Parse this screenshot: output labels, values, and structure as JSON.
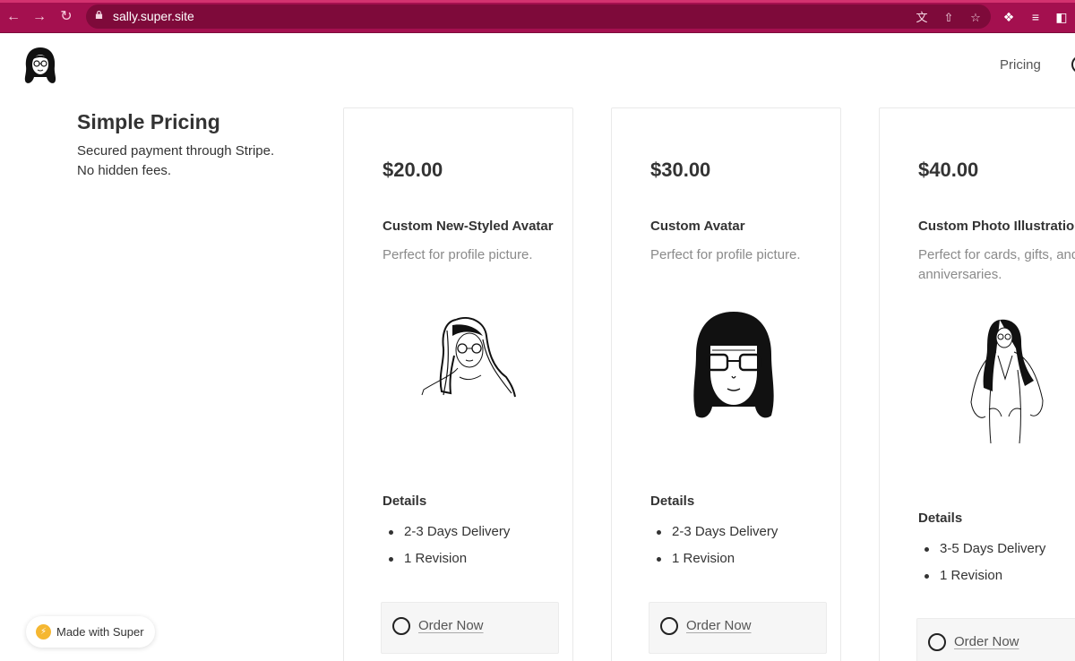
{
  "browser": {
    "url": "sally.super.site",
    "theme_color": "#a4104f"
  },
  "header": {
    "nav_pricing": "Pricing"
  },
  "intro": {
    "title": "Simple Pricing",
    "line1": "Secured payment through Stripe.",
    "line2": "No hidden fees."
  },
  "cards": [
    {
      "price": "$20.00",
      "name": "Custom New-Styled Avatar",
      "description": "Perfect for profile picture.",
      "illustration": "avatar-sketch-icon",
      "details_label": "Details",
      "details": [
        "2-3 Days Delivery",
        "1 Revision"
      ],
      "button_label": "Order Now"
    },
    {
      "price": "$30.00",
      "name": "Custom Avatar",
      "description": "Perfect for profile picture.",
      "illustration": "avatar-bold-icon",
      "details_label": "Details",
      "details": [
        "2-3 Days Delivery",
        "1 Revision"
      ],
      "button_label": "Order Now"
    },
    {
      "price": "$40.00",
      "name": "Custom Photo Illustration",
      "description": "Perfect for cards, gifts, and anniversaries.",
      "illustration": "full-body-illustration-icon",
      "details_label": "Details",
      "details": [
        "3-5 Days Delivery",
        "1 Revision"
      ],
      "button_label": "Order Now"
    }
  ],
  "badge": {
    "label": "Made with Super"
  }
}
